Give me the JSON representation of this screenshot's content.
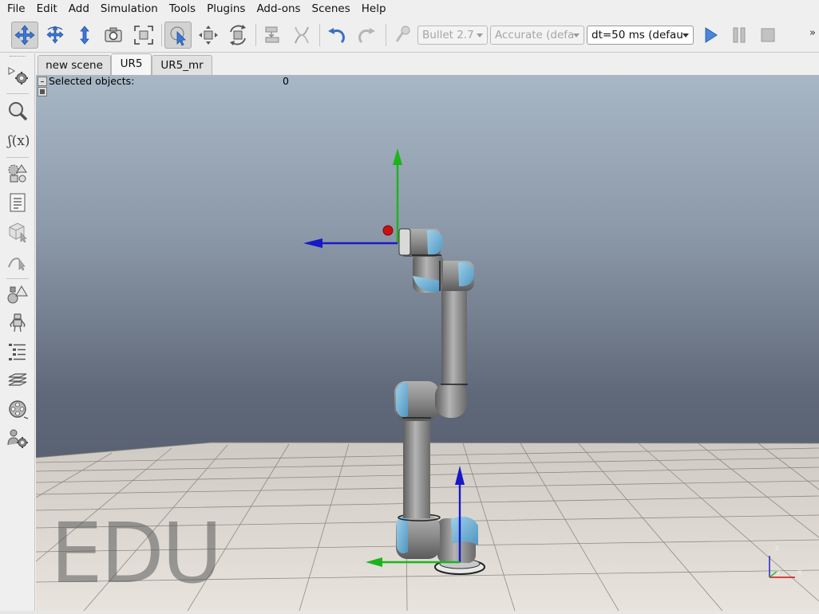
{
  "menu": [
    "File",
    "Edit",
    "Add",
    "Simulation",
    "Tools",
    "Plugins",
    "Add-ons",
    "Scenes",
    "Help"
  ],
  "toolbar": {
    "engine": "Bullet 2.7",
    "accuracy": "Accurate (defa",
    "timestep": "dt=50 ms (defau",
    "more": "»"
  },
  "tabs": [
    "new scene",
    "UR5",
    "UR5_mr"
  ],
  "active_tab": "UR5",
  "viewport": {
    "selected_label": "Selected objects:",
    "selected_count": "0",
    "watermark": "EDU",
    "axis_z": "z",
    "axis_y": "y",
    "axis_x": "x"
  },
  "colors": {
    "accent": "#3b78d8",
    "robot_blue": "#6eb4dc",
    "axis_x": "#d01010",
    "axis_y": "#1bb51b",
    "axis_z": "#1818c8"
  },
  "icons": {
    "toolbar": [
      "camera-pan-icon",
      "camera-rotate-icon",
      "camera-shift-icon",
      "camera-angle-icon",
      "fit-to-view-icon",
      "click-select-icon",
      "object-shift-icon",
      "object-rotate-icon",
      "assembly-icon",
      "transfer-dna-icon",
      "undo-icon",
      "redo-icon",
      "dynamics-toggle-icon",
      "start-simulation-icon",
      "pause-simulation-icon",
      "stop-simulation-icon"
    ],
    "left": [
      "simulation-settings-icon",
      "model-browser-icon",
      "scene-hierarchy-icon",
      "calc-modules-icon",
      "collections-icon",
      "scripts-icon",
      "shape-edit-icon",
      "path-edit-icon",
      "selection-icon",
      "model-icon",
      "layers-icon",
      "video-recorder-icon",
      "user-settings-icon"
    ]
  }
}
